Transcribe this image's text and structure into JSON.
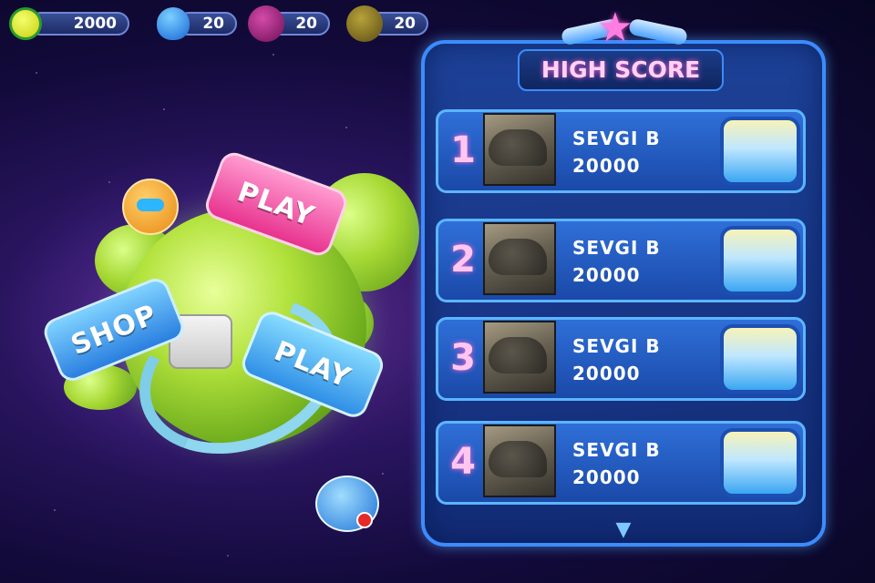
{
  "resources": [
    {
      "name": "coins",
      "value": "2000",
      "color": "#d8e01c",
      "icon": "coin-icon"
    },
    {
      "name": "blue-gems",
      "value": "20",
      "color": "#1f8ee8",
      "icon": "blue-balloon-icon"
    },
    {
      "name": "purple-gems",
      "value": "20",
      "color": "#9a1a7a",
      "icon": "purple-orb-icon"
    },
    {
      "name": "olive-gems",
      "value": "20",
      "color": "#7a6a1c",
      "icon": "olive-orb-icon"
    }
  ],
  "menu": {
    "play_top": "PLAY",
    "shop": "SHOP",
    "play_bottom": "PLAY"
  },
  "highscore": {
    "title": "HIGH SCORE",
    "rows": [
      {
        "rank": "1",
        "name": "SEVGI B",
        "score": "20000"
      },
      {
        "rank": "2",
        "name": "SEVGI B",
        "score": "20000"
      },
      {
        "rank": "3",
        "name": "SEVGI B",
        "score": "20000"
      },
      {
        "rank": "4",
        "name": "SEVGI B",
        "score": "20000"
      }
    ]
  },
  "colors": {
    "panel_border": "#3b8cff",
    "title_pink": "#ffd2f4",
    "play_pink": "#e8338f",
    "shop_blue": "#2a7fe0"
  }
}
